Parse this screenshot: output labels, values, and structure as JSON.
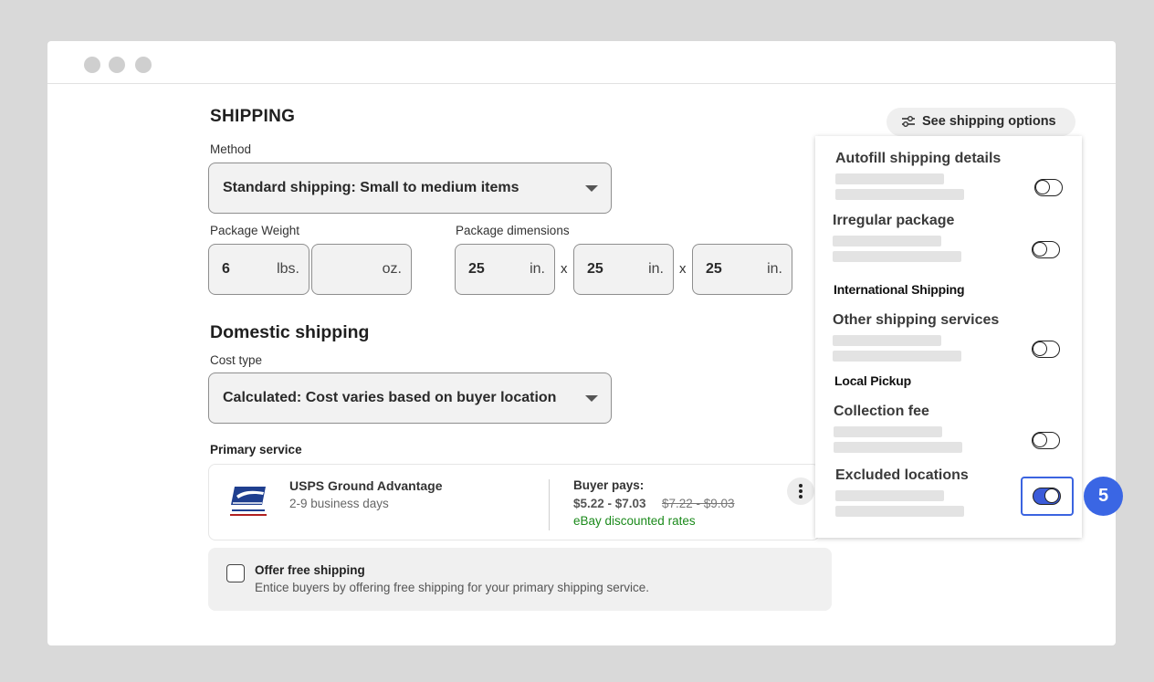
{
  "shipping": {
    "heading": "SHIPPING",
    "method_label": "Method",
    "method_value": "Standard shipping: Small to medium items",
    "weight_label": "Package Weight",
    "weight_lbs": "6",
    "weight_lbs_unit": "lbs.",
    "weight_oz": "",
    "weight_oz_unit": "oz.",
    "dimensions_label": "Package dimensions",
    "dim_unit": "in.",
    "dim_separator": "x",
    "dim_length": "25",
    "dim_width": "25",
    "dim_height": "25"
  },
  "domestic": {
    "heading": "Domestic shipping",
    "cost_type_label": "Cost type",
    "cost_type_value": "Calculated: Cost varies based on buyer location",
    "primary_service_label": "Primary service",
    "service": {
      "name": "USPS Ground Advantage",
      "days": "2-9 business days",
      "buyer_pays_label": "Buyer pays:",
      "price": "$5.22 - $7.03",
      "old_price": "$7.22 - $9.03",
      "discount_note": "eBay discounted rates"
    },
    "free_shipping_title": "Offer free shipping",
    "free_shipping_desc": "Entice buyers by offering free shipping for your primary shipping service.",
    "free_shipping_checked": false
  },
  "options": {
    "button_label": "See shipping options",
    "items": [
      {
        "title": "Autofill shipping details",
        "enabled": false
      },
      {
        "title": "Irregular package",
        "enabled": false
      },
      {
        "title": "Other shipping services",
        "enabled": false
      },
      {
        "title": "Collection fee",
        "enabled": false
      },
      {
        "title": "Excluded locations",
        "enabled": true
      }
    ],
    "section_international": "International Shipping",
    "section_local": "Local Pickup"
  },
  "step_badge": "5",
  "colors": {
    "accent": "#3a66e4",
    "discount": "#1b8a1b",
    "field_bg": "#f2f2f2"
  }
}
